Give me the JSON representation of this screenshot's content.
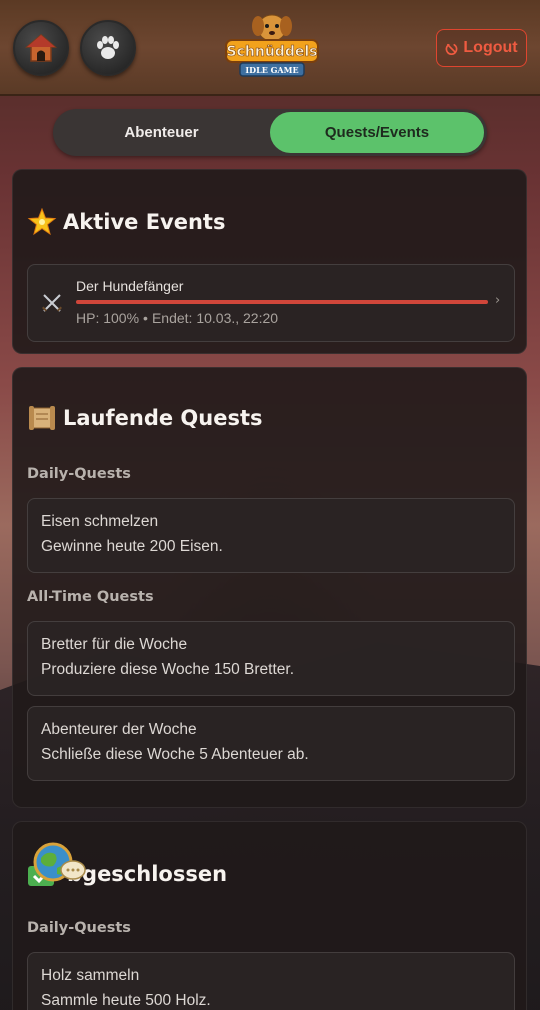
{
  "header": {
    "logo": {
      "line1": "Schnüddels",
      "line2": "IDLE GAME"
    },
    "icons": {
      "home": "doghouse-icon",
      "paw": "paw-icon",
      "logout": "power-icon"
    },
    "logout_label": "Logout"
  },
  "tabs": [
    {
      "label": "Abenteuer",
      "active": false
    },
    {
      "label": "Quests/Events",
      "active": true
    }
  ],
  "events_panel": {
    "title": "Aktive Events",
    "icon": "star-icon",
    "events": [
      {
        "name": "Der Hundefänger",
        "hp_label": "HP: 100%",
        "separator": "•",
        "ends_label": "Endet: 10.03., 22:20",
        "hp_fraction": 1.0,
        "icon": "crossed-swords-icon"
      }
    ]
  },
  "running_panel": {
    "title": "Laufende Quests",
    "icon": "scroll-icon",
    "daily_label": "Daily-Quests",
    "daily": [
      {
        "title": "Eisen schmelzen",
        "desc": "Gewinne heute 200 Eisen."
      }
    ],
    "alltime_label": "All-Time Quests",
    "alltime": [
      {
        "title": "Bretter für die Woche",
        "desc": "Produziere diese Woche 150 Bretter."
      },
      {
        "title": "Abenteurer der Woche",
        "desc": "Schließe diese Woche 5 Abenteuer ab."
      }
    ]
  },
  "done_panel": {
    "title": "Abgeschlossen",
    "title_visible": "bgeschlossen",
    "icon": "check-icon",
    "overlay_icon": "globe-chat-icon",
    "daily_label": "Daily-Quests",
    "daily": [
      {
        "title": "Holz sammeln",
        "desc": "Sammle heute 500 Holz."
      }
    ]
  },
  "colors": {
    "accent_green": "#5cc26b",
    "logout_red": "#ef5b41",
    "hp_bar": "#d0463a"
  }
}
